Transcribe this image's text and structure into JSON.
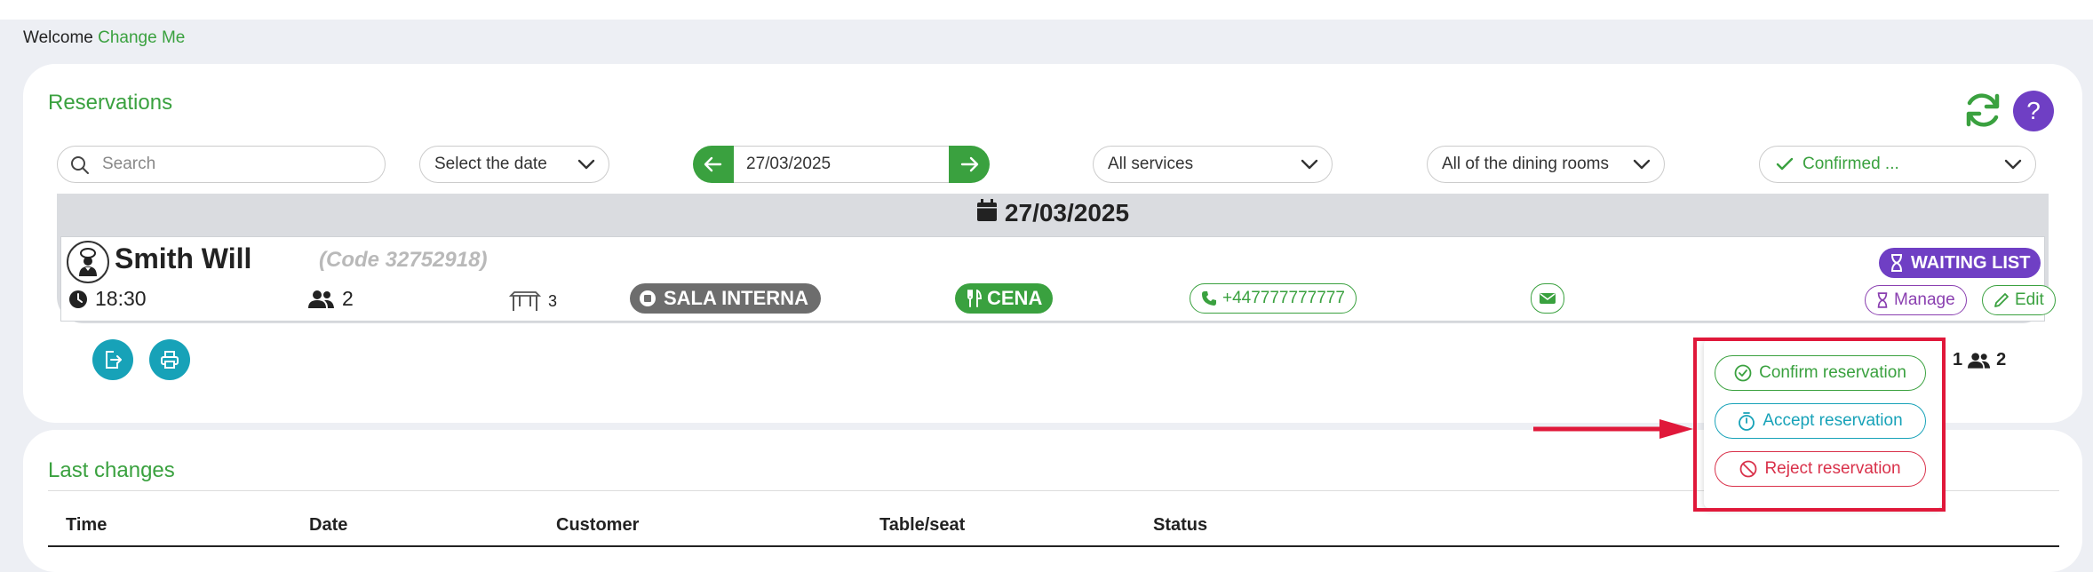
{
  "header": {
    "welcome": "Welcome",
    "user": "Change Me"
  },
  "reservations": {
    "title": "Reservations",
    "help_label": "?",
    "search": {
      "placeholder": "Search"
    },
    "date_select": "Select the date",
    "date_value": "27/03/2025",
    "services": "All services",
    "rooms": "All of the dining rooms",
    "status": "Confirmed ...",
    "day_header": "27/03/2025",
    "row": {
      "name": "Smith Will",
      "code": "(Code 32752918)",
      "time": "18:30",
      "guests": "2",
      "table": "3",
      "room": "SALA INTERNA",
      "service": "CENA",
      "phone": "+447777777777",
      "waiting": "WAITING LIST",
      "manage": "Manage",
      "edit": "Edit"
    },
    "totals": {
      "tables": "1",
      "guests": "2"
    }
  },
  "last_changes": {
    "title": "Last changes",
    "columns": [
      "Time",
      "Date",
      "Customer",
      "Table/seat",
      "Status"
    ]
  },
  "popup": {
    "confirm": "Confirm reservation",
    "accept": "Accept reservation",
    "reject": "Reject reservation"
  },
  "colors": {
    "accent": "#3aa13f",
    "purple": "#6f3fc4",
    "teal": "#17a2b8",
    "danger": "#d9314a",
    "highlight": "#e0183a"
  }
}
